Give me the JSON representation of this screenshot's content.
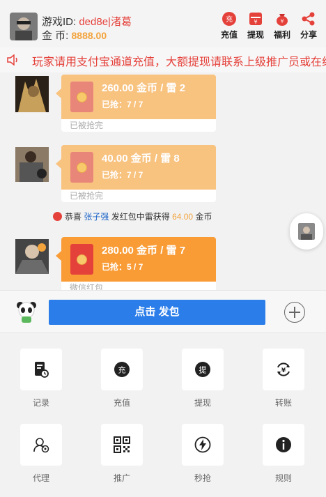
{
  "header": {
    "id_label": "游戏ID:",
    "id_value": "ded8e|渚葛",
    "coin_label": "金   币:",
    "coin_value": "8888.00",
    "actions": [
      {
        "label": "充值",
        "icon": "recharge-icon"
      },
      {
        "label": "提现",
        "icon": "withdraw-icon"
      },
      {
        "label": "福利",
        "icon": "welfare-bag-icon"
      },
      {
        "label": "分享",
        "icon": "share-icon"
      }
    ]
  },
  "notice": {
    "text": "玩家请用支付宝通道充值，大额提现请联系上级推广员或在线客服"
  },
  "messages": [
    {
      "amount": "260.00 金币 / 雷 2",
      "grabbed": "已抢：7 / 7",
      "status": "已被抢完"
    },
    {
      "amount": "40.00 金币 / 雷 8",
      "grabbed": "已抢：7 / 7",
      "status": "已被抢完"
    },
    {
      "amount": "280.00 金币 / 雷 7",
      "grabbed": "已抢：5 / 7",
      "status": "微信红包"
    }
  ],
  "win_notice": {
    "prefix": "恭喜",
    "name": "张子强",
    "middle": "发红包中雷获得",
    "amount": "64.00",
    "suffix": "金币"
  },
  "send_bar": {
    "send_label": "点击 发包"
  },
  "menu": [
    {
      "label": "记录",
      "icon": "record-icon"
    },
    {
      "label": "充值",
      "icon": "recharge-icon"
    },
    {
      "label": "提现",
      "icon": "withdraw-icon"
    },
    {
      "label": "转账",
      "icon": "transfer-icon"
    },
    {
      "label": "代理",
      "icon": "agent-icon"
    },
    {
      "label": "推广",
      "icon": "qrcode-icon"
    },
    {
      "label": "秒抢",
      "icon": "lightning-icon"
    },
    {
      "label": "规则",
      "icon": "info-icon"
    }
  ],
  "colors": {
    "accent_blue": "#2b7de9",
    "red": "#e5413b",
    "gold": "#f3a33c",
    "bubble_opened": "#f8c27f",
    "bubble_active": "#f99c36"
  }
}
